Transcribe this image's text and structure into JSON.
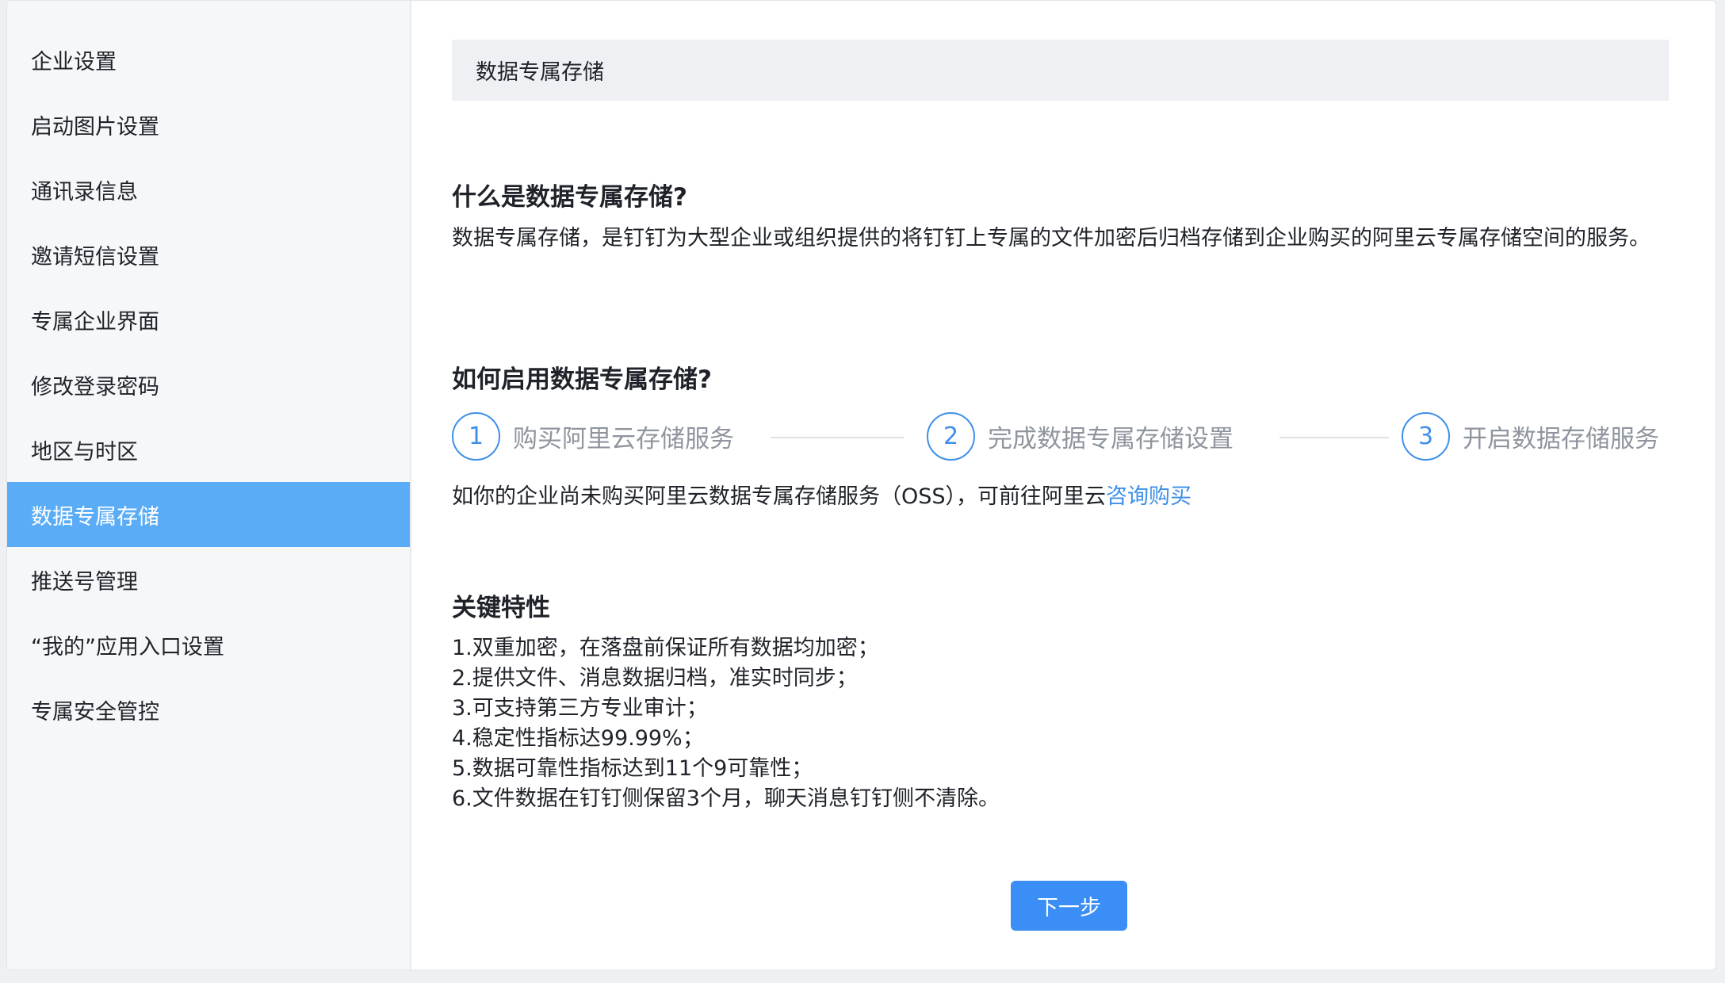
{
  "sidebar": {
    "items": [
      {
        "label": "企业设置",
        "active": false
      },
      {
        "label": "启动图片设置",
        "active": false
      },
      {
        "label": "通讯录信息",
        "active": false
      },
      {
        "label": "邀请短信设置",
        "active": false
      },
      {
        "label": "专属企业界面",
        "active": false
      },
      {
        "label": "修改登录密码",
        "active": false
      },
      {
        "label": "地区与时区",
        "active": false
      },
      {
        "label": "数据专属存储",
        "active": true
      },
      {
        "label": "推送号管理",
        "active": false
      },
      {
        "label": "“我的”应用入口设置",
        "active": false
      },
      {
        "label": "专属安全管控",
        "active": false
      }
    ]
  },
  "main": {
    "page_title": "数据专属存储",
    "what_heading": "什么是数据专属存储?",
    "what_text": "数据专属存储，是钉钉为大型企业或组织提供的将钉钉上专属的文件加密后归档存储到企业购买的阿里云专属存储空间的服务。",
    "how_heading": "如何启用数据专属存储?",
    "steps": [
      {
        "number": "1",
        "label": "购买阿里云存储服务"
      },
      {
        "number": "2",
        "label": "完成数据专属存储设置"
      },
      {
        "number": "3",
        "label": "开启数据存储服务"
      }
    ],
    "purchase_hint": "如你的企业尚未购买阿里云数据专属存储服务（OSS），可前往阿里云",
    "purchase_link": "咨询购买",
    "features_heading": "关键特性",
    "features": [
      "1.双重加密，在落盘前保证所有数据均加密；",
      "2.提供文件、消息数据归档，准实时同步；",
      "3.可支持第三方专业审计；",
      "4.稳定性指标达99.99%；",
      "5.数据可靠性指标达到11个9可靠性；",
      "6.文件数据在钉钉侧保留3个月，聊天消息钉钉侧不清除。"
    ],
    "next_button": "下一步"
  },
  "colors": {
    "accent": "#3a8ef6",
    "sidebar_active": "#5aacf7",
    "step_blue": "#3e8fe8",
    "step_text": "#8f959e"
  }
}
